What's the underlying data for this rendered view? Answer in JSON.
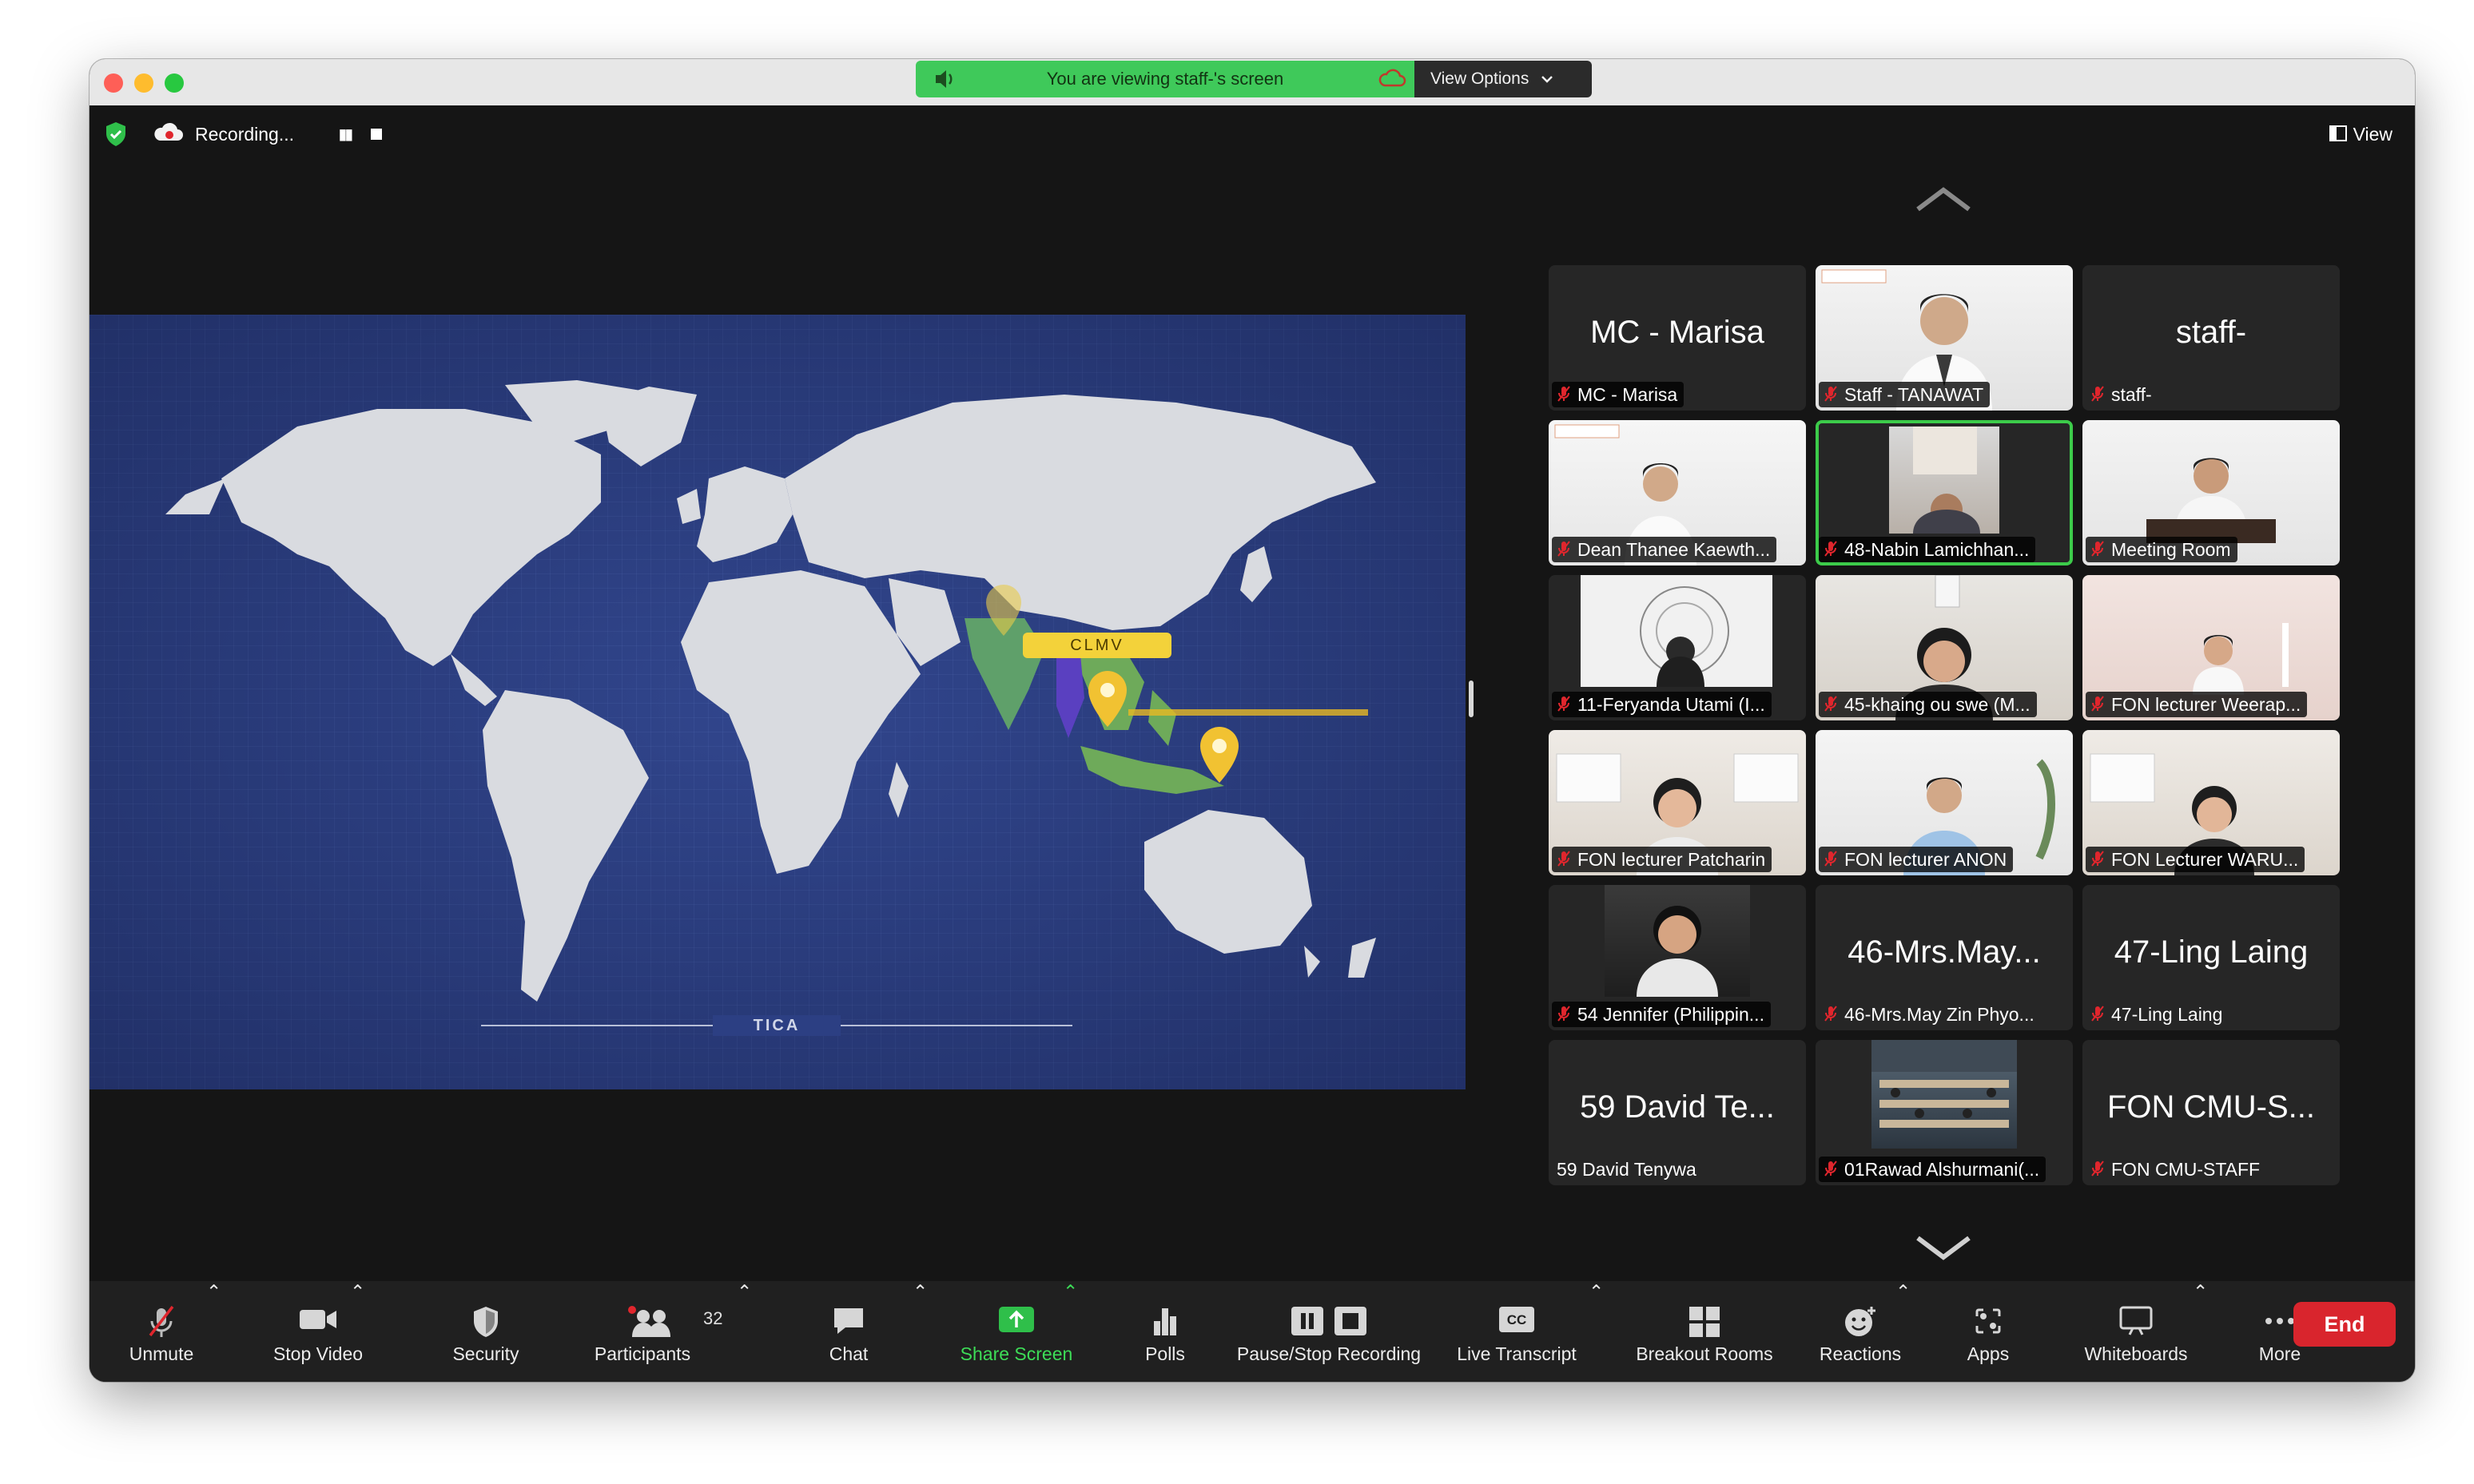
{
  "banner": {
    "viewing_text": "You are viewing staff-'s screen",
    "view_options_label": "View Options"
  },
  "topbar": {
    "recording_label": "Recording...",
    "view_label": "View"
  },
  "shared_screen": {
    "clmv_label": "CLMV",
    "footer_label": "TICA"
  },
  "tiles": [
    {
      "big": "MC - Marisa",
      "label": "MC - Marisa"
    },
    {
      "big": "",
      "label": "Staff - TANAWAT"
    },
    {
      "big": "staff-",
      "label": "staff-"
    },
    {
      "big": "",
      "label": "Dean Thanee Kaewth..."
    },
    {
      "big": "",
      "label": "48-Nabin Lamichhan..."
    },
    {
      "big": "",
      "label": "Meeting Room"
    },
    {
      "big": "",
      "label": "11-Feryanda Utami (I..."
    },
    {
      "big": "",
      "label": "45-khaing ou swe (M..."
    },
    {
      "big": "",
      "label": "FON lecturer Weerap..."
    },
    {
      "big": "",
      "label": "FON lecturer Patcharin"
    },
    {
      "big": "",
      "label": "FON lecturer ANON"
    },
    {
      "big": "",
      "label": "FON Lecturer WARU..."
    },
    {
      "big": "",
      "label": "54 Jennifer (Philippin..."
    },
    {
      "big": "46-Mrs.May...",
      "label": "46-Mrs.May Zin Phyo..."
    },
    {
      "big": "47-Ling Laing",
      "label": "47-Ling Laing"
    },
    {
      "big": "59 David  Te...",
      "label": "59 David  Tenywa"
    },
    {
      "big": "",
      "label": "01Rawad Alshurmani(..."
    },
    {
      "big": "FON CMU-S...",
      "label": "FON CMU-STAFF"
    }
  ],
  "toolbar": {
    "unmute": "Unmute",
    "stop_video": "Stop Video",
    "security": "Security",
    "participants": "Participants",
    "participants_count": "32",
    "chat": "Chat",
    "share_screen": "Share Screen",
    "polls": "Polls",
    "pause_stop_recording": "Pause/Stop Recording",
    "live_transcript": "Live Transcript",
    "cc_badge": "CC",
    "breakout_rooms": "Breakout Rooms",
    "reactions": "Reactions",
    "apps": "Apps",
    "whiteboards": "Whiteboards",
    "more": "More",
    "end": "End"
  },
  "colors": {
    "banner_green": "#3fc95a",
    "active_speaker": "#3ccb4a",
    "end_red": "#d9252d",
    "mute_red": "#e0262d",
    "map_background": "#2c3f83"
  }
}
